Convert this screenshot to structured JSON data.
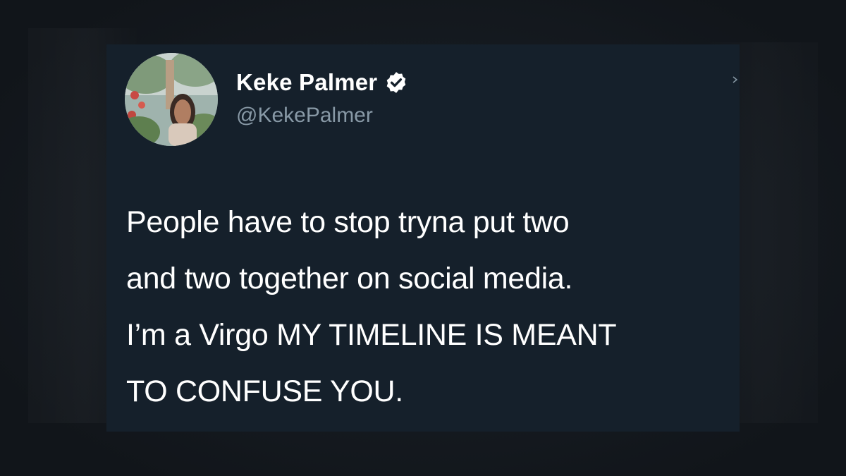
{
  "tweet": {
    "author": {
      "name": "Keke Palmer",
      "handle": "@KekePalmer",
      "verified_icon": "verified-badge-icon"
    },
    "text_lines": [
      "People have to stop tryna put two",
      "and two together on social media.",
      "I’m a Virgo MY TIMELINE IS MEANT",
      "TO CONFUSE YOU."
    ]
  },
  "colors": {
    "background": "#151a20",
    "card": "#15202b",
    "text_primary": "#ffffff",
    "text_secondary": "#8899a6"
  }
}
